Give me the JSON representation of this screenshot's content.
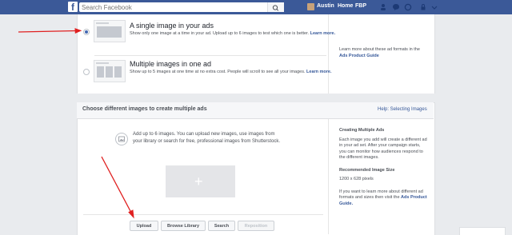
{
  "topbar": {
    "search_placeholder": "Search Facebook",
    "user_name": "Austin",
    "nav_home": "Home",
    "nav_fbp": "FBP"
  },
  "options": [
    {
      "title": "A single image in your ads",
      "description": "Show only one image at a time in your ad. Upload up to 6 images to test which one is better.",
      "learn_more": "Learn more.",
      "selected": true
    },
    {
      "title": "Multiple images in one ad",
      "description": "Show up to 5 images at one time at no extra cost. People will scroll to see all your images.",
      "learn_more": "Learn more.",
      "selected": false
    }
  ],
  "side_note": {
    "text": "Learn more about these ad formats in the",
    "link": "Ads Product Guide"
  },
  "section": {
    "title": "Choose different images to create multiple ads",
    "help": "Help: Selecting Images"
  },
  "add_images": {
    "text": "Add up to 6 images. You can upload new images, use images from your library or search for free, professional images from Shutterstock.",
    "plus": "+"
  },
  "info": {
    "heading1": "Creating Multiple Ads",
    "para1": "Each image you add will create a different ad in your ad set. After your campaign starts, you can monitor how audiences respond to the different images.",
    "heading2": "Recommended Image Size",
    "size": "1200 x 628 pixels",
    "para2": "If you want to learn more about different ad formats and sizes then visit the",
    "link": "Ads Product Guide."
  },
  "buttons": {
    "upload": "Upload",
    "browse": "Browse Library",
    "search": "Search",
    "reposition": "Reposition"
  },
  "colors": {
    "brand": "#3b5998",
    "link": "#365899",
    "arrow": "#e02020"
  }
}
